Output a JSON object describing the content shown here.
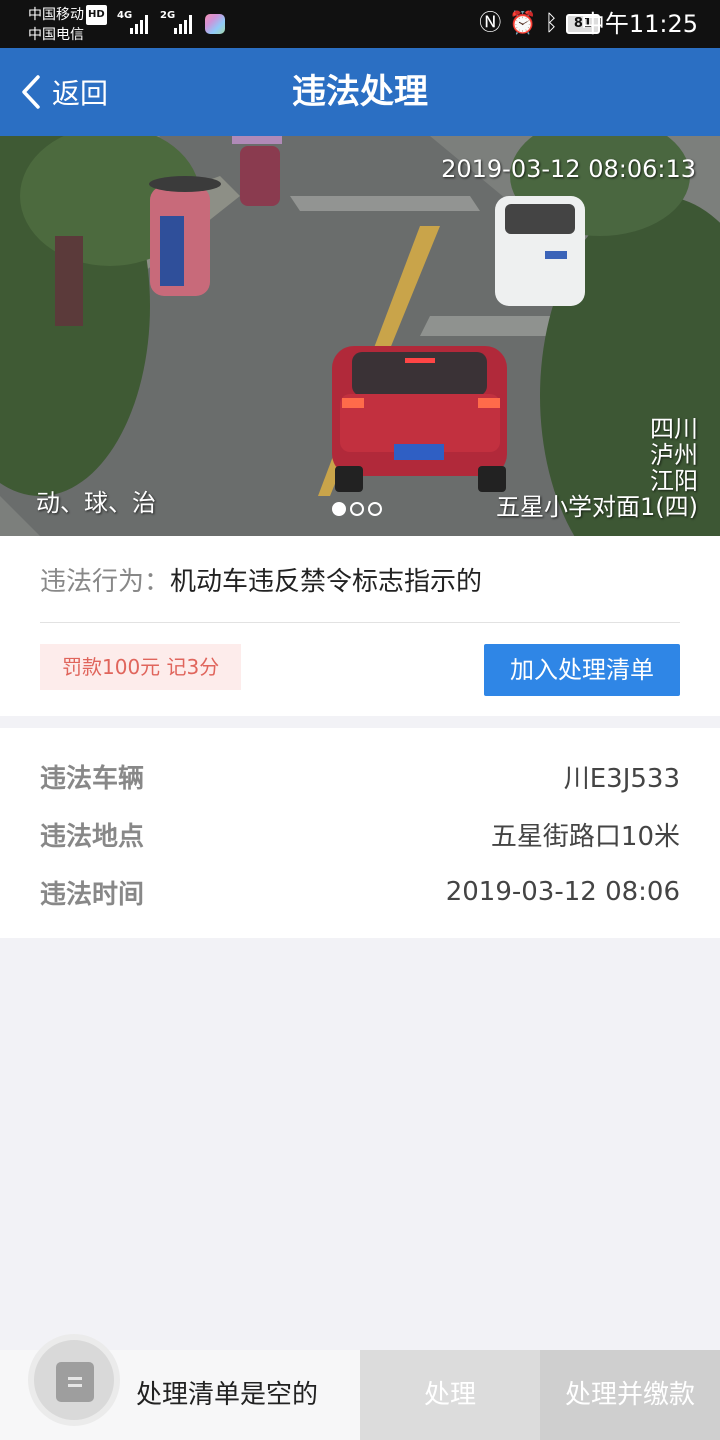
{
  "status_bar": {
    "carrier_1": "中国移动",
    "carrier_1_badge": "HD",
    "carrier_2": "中国电信",
    "net_1": "4G",
    "net_2": "2G",
    "battery": "81",
    "time": "中午11:25",
    "icons": [
      "nfc-icon",
      "alarm-icon",
      "bluetooth-icon"
    ]
  },
  "nav": {
    "back_label": "返回",
    "title": "违法处理"
  },
  "photo": {
    "timestamp": "2019-03-12  08:06:13",
    "location_lines": [
      "四川",
      "泸州",
      "江阳",
      "五星小学对面1(四)"
    ],
    "overlay_label": "动、球、治",
    "pager": {
      "count": 3,
      "active": 1
    }
  },
  "violation": {
    "behavior_key": "违法行为：",
    "behavior_value": "机动车违反禁令标志指示的",
    "fine": "罚款100元 记3分",
    "add_button": "加入处理清单"
  },
  "details": [
    {
      "key": "违法车辆",
      "value": "川E3J533"
    },
    {
      "key": "违法地点",
      "value": "五星街路口10米"
    },
    {
      "key": "违法时间",
      "value": "2019-03-12 08:06"
    }
  ],
  "bottom": {
    "empty_text": "处理清单是空的",
    "process_button": "处理",
    "pay_button": "处理并缴款"
  },
  "colors": {
    "nav_bg": "#2b6fc3",
    "primary_button": "#2f86e6",
    "fine_text": "#e0655c",
    "fine_bg": "#fdeceb"
  }
}
